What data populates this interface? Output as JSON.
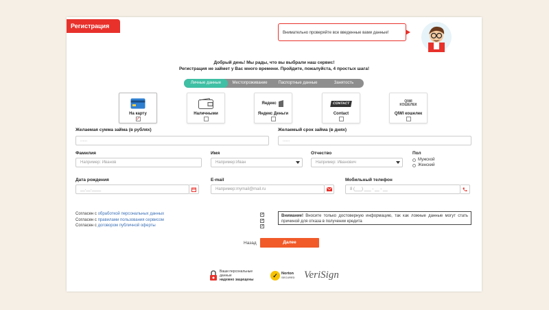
{
  "header": {
    "title": "Регистрация",
    "notice": "Внимательно проверяйте все введенные вами данные!"
  },
  "intro": {
    "line1": "Добрый день! Мы рады, что вы выбрали наш сервис!",
    "line2": "Регистрация не займет у Вас много времени. Пройдите, пожалуйста, 4 простых шага!"
  },
  "steps": [
    {
      "label": "Личные данные",
      "active": true
    },
    {
      "label": "Местопроживание",
      "active": false
    },
    {
      "label": "Паспортные данные",
      "active": false
    },
    {
      "label": "Занятость",
      "active": false
    }
  ],
  "payment": {
    "card": {
      "label": "На карту",
      "checked": "✓"
    },
    "cash": {
      "label": "Наличными"
    },
    "yandex": {
      "label": "Яндекс Деньги",
      "logo": "Яндекс"
    },
    "contact": {
      "label": "Contact",
      "logo": "CONTACT"
    },
    "qiwi": {
      "label": "QIWI кошелек",
      "logo1": "QIWI",
      "logo2": "КОШЕЛЕК"
    }
  },
  "form": {
    "amount": {
      "label": "Желаемая сумма займа (в рублях)",
      "value": "......"
    },
    "term": {
      "label": "Желаемый срок займа (в днях)",
      "value": "......"
    },
    "lastname": {
      "label": "Фамилия",
      "placeholder": "Например: Иванов"
    },
    "firstname": {
      "label": "Имя",
      "placeholder": "Например:Иван"
    },
    "patronymic": {
      "label": "Отчество",
      "placeholder": "Например: Иванович"
    },
    "gender": {
      "label": "Пол",
      "male": "Мужской",
      "female": "Женский"
    },
    "birthdate": {
      "label": "Дата рождения",
      "placeholder": "__.__.____"
    },
    "email": {
      "label": "E-mail",
      "placeholder": "Например:mymail@mail.ru"
    },
    "phone": {
      "label": "Мобильный телефон",
      "placeholder": "8 (___) ___ - __ - __"
    }
  },
  "agreements": [
    {
      "prefix": "Согласен с ",
      "link": "обработкой персональных данных",
      "checked": "✓"
    },
    {
      "prefix": "Согласен с ",
      "link": "правилами пользования сервисом",
      "checked": "✓"
    },
    {
      "prefix": "Согласен с ",
      "link": "договором публичной оферты",
      "checked": "✓"
    }
  ],
  "warning": {
    "bold": "Внимание!",
    "text": " Вносите только достоверную информацию, так как ложные данные могут стать причиной для отказа в получении кредита"
  },
  "nav": {
    "back": "Назад",
    "next": "Далее"
  },
  "footer": {
    "secure_line1": "Ваши персональные данные",
    "secure_line2": "надежно защищены",
    "norton_line1": "Norton",
    "norton_line2": "SECURED",
    "verisign": "VeriSign"
  },
  "colors": {
    "accent": "#e8312b",
    "button": "#f15a29",
    "step_active": "#3fbfa4",
    "link": "#3a6fb5"
  }
}
